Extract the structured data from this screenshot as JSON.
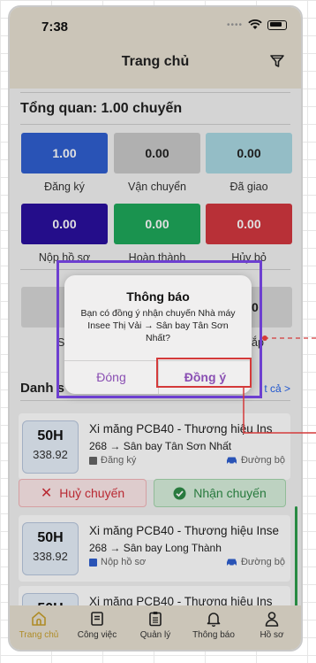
{
  "status_bar": {
    "time": "7:38"
  },
  "header": {
    "title": "Trang chủ"
  },
  "overview": {
    "title": "Tổng quan: 1.00 chuyến",
    "stats": [
      {
        "value": "1.00",
        "label": "Đăng ký",
        "color": "#2f5fd0"
      },
      {
        "value": "0.00",
        "label": "Vận chuyển",
        "color": "#c9c9c9"
      },
      {
        "value": "0.00",
        "label": "Đã giao",
        "color": "#a9d8e2"
      },
      {
        "value": "0.00",
        "label": "Nộp hồ sơ",
        "color": "#2a0f9e"
      },
      {
        "value": "0.00",
        "label": "Hoàn thành",
        "color": "#1ea85a"
      },
      {
        "value": "0.00",
        "label": "Hủy bỏ",
        "color": "#d2373f"
      }
    ],
    "partial_row": {
      "left_value": "1.",
      "left_label": "Số ch",
      "right_value": "0",
      "right_label": "ắp"
    }
  },
  "list_section": {
    "title": "Danh s",
    "see_all": "t cả >"
  },
  "trips": [
    {
      "plate": "50H",
      "weight": "338.92",
      "title": "Xi măng PCB40 - Thương hiệu Ins",
      "route": "268 → Sân bay Tân Sơn Nhất",
      "status": "Đăng ký",
      "status_color": "#666666",
      "mode": "Đường bộ"
    },
    {
      "plate": "50H",
      "weight": "338.92",
      "title": "Xi măng PCB40 - Thương hiệu Inse",
      "route": "268 → Sân bay Long Thành",
      "status": "Nộp hồ sơ",
      "status_color": "#2f5fd0",
      "mode": "Đường bộ"
    },
    {
      "plate": "50H",
      "weight": "",
      "title": "Xi măng PCB40 - Thương hiệu Ins"
    }
  ],
  "actions": {
    "cancel_label": "Huỷ chuyến",
    "accept_label": "Nhận chuyến"
  },
  "dialog": {
    "title": "Thông báo",
    "message": "Bạn có đồng ý nhận chuyến Nhà máy Insee Thị Vải → Sân bay Tân Sơn Nhất?",
    "cancel_label": "Đóng",
    "confirm_label": "Đồng ý"
  },
  "tabbar": [
    {
      "label": "Trang chủ",
      "icon": "home-icon",
      "active": true
    },
    {
      "label": "Công việc",
      "icon": "tasks-icon",
      "active": false
    },
    {
      "label": "Quản lý",
      "icon": "clipboard-icon",
      "active": false
    },
    {
      "label": "Thông báo",
      "icon": "bell-icon",
      "active": false
    },
    {
      "label": "Hồ sơ",
      "icon": "user-icon",
      "active": false
    }
  ],
  "colors": {
    "accent": "#c8a02d",
    "annotation_purple": "#6d3fd0",
    "annotation_red": "#d43a3a"
  }
}
